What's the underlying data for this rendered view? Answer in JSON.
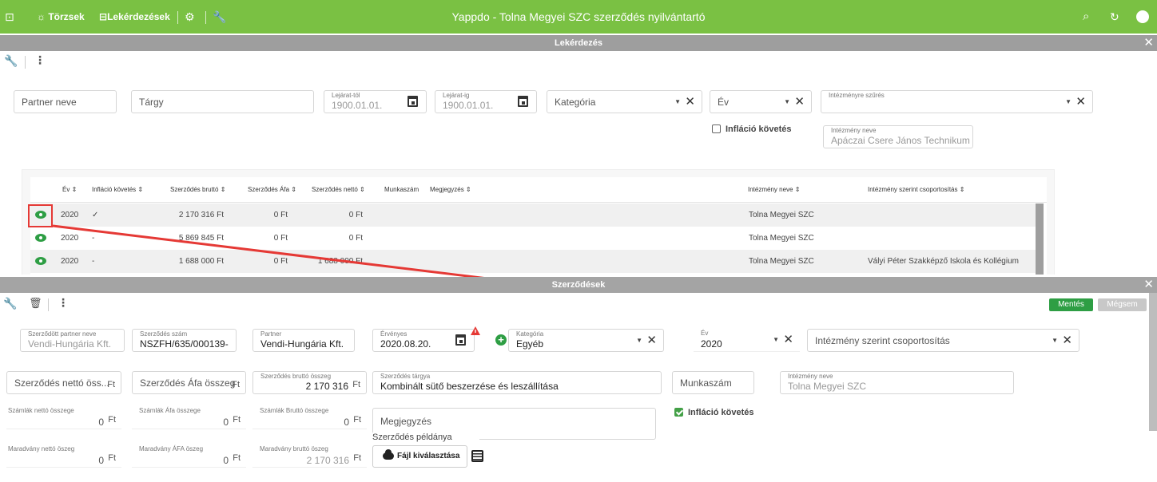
{
  "topbar": {
    "title": "Yappdo - Tolna Megyei SZC szerződés nyilvántartó",
    "nav_torzsek": "Törzsek",
    "nav_lekerdezesek": "Lekérdezések"
  },
  "query_panel": {
    "title": "Lekérdezés",
    "filters": {
      "partner_placeholder": "Partner neve",
      "targy_placeholder": "Tárgy",
      "lejarat_tol_label": "Lejárat-tól",
      "lejarat_tol_value": "1900.01.01.",
      "lejarat_ig_label": "Lejárat-ig",
      "lejarat_ig_value": "1900.01.01.",
      "kategoria_placeholder": "Kategória",
      "ev_placeholder": "Év",
      "intezmenyre_label": "Intézményre szűrés",
      "inflacio_label": "Infláció követés",
      "intezmeny_neve_label": "Intézmény neve",
      "intezmeny_neve_value": "Apáczai Csere János Technikum"
    },
    "grid": {
      "headers": {
        "ev": "Év",
        "inflacio": "Infláció követés",
        "brutto": "Szerződés bruttó",
        "afa": "Szerződés Áfa",
        "netto": "Szerződés nettó",
        "munkaszam": "Munkaszám",
        "megjegyzes": "Megjegyzés",
        "intezmeny": "Intézmény neve",
        "csoport": "Intézmény szerint csoportosítás"
      },
      "sort_glyph": "⇕",
      "rows": [
        {
          "ev": "2020",
          "inflacio": "✓",
          "brutto": "2 170 316 Ft",
          "afa": "0 Ft",
          "netto": "0 Ft",
          "intezmeny": "Tolna Megyei SZC",
          "csoport": ""
        },
        {
          "ev": "2020",
          "inflacio": "-",
          "brutto": "5 869 845 Ft",
          "afa": "0 Ft",
          "netto": "0 Ft",
          "intezmeny": "Tolna Megyei SZC",
          "csoport": ""
        },
        {
          "ev": "2020",
          "inflacio": "-",
          "brutto": "1 688 000 Ft",
          "afa": "0 Ft",
          "netto": "1 688 000 Ft",
          "intezmeny": "Tolna Megyei SZC",
          "csoport": "Vályi Péter Szakképző Iskola és Kollégium"
        }
      ]
    }
  },
  "contract_panel": {
    "title": "Szerződések",
    "save_label": "Mentés",
    "cancel_label": "Mégsem",
    "fields": {
      "szerzodott_partner_label": "Szerződött partner neve",
      "szerzodott_partner_value": "Vendi-Hungária Kft.",
      "szerzodes_szam_label": "Szerződés szám",
      "szerzodes_szam_value": "NSZFH/635/000139-",
      "partner_label": "Partner",
      "partner_value": "Vendi-Hungária Kft.",
      "ervenyes_label": "Érvényes",
      "ervenyes_value": "2020.08.20.",
      "kategoria_label": "Kategória",
      "kategoria_value": "Egyéb",
      "ev_label": "Év",
      "ev_value": "2020",
      "csoport_placeholder": "Intézmény szerint csoportosítás",
      "netto_placeholder": "Szerződés nettó öss...",
      "afa_placeholder": "Szerződés Áfa összeg",
      "brutto_label": "Szerződés bruttó összeg",
      "brutto_value": "2 170 316",
      "targy_label": "Szerződés tárgya",
      "targy_value": "Kombinált sütő beszerzése és leszállítása",
      "munkaszam_placeholder": "Munkaszám",
      "intezmeny_neve_label": "Intézmény neve",
      "intezmeny_neve_value": "Tolna Megyei SZC",
      "szamlak_netto_label": "Számlák nettó összege",
      "szamlak_netto_value": "0",
      "szamlak_afa_label": "Számlák Áfa összege",
      "szamlak_afa_value": "0",
      "szamlak_brutto_label": "Számlák Bruttó összege",
      "szamlak_brutto_value": "0",
      "megjegyzes_placeholder": "Megjegyzés",
      "peldany_label": "Szerződés példánya",
      "file_button": "Fájl kiválasztása",
      "inflacio_label": "Infláció követés",
      "maradvany_netto_label": "Maradvány nettó öszeg",
      "maradvany_netto_value": "0",
      "maradvany_afa_label": "Maradvány ÁFA öszeg",
      "maradvany_afa_value": "0",
      "maradvany_brutto_label": "Maradvány bruttó öszeg",
      "maradvany_brutto_value": "2 170 316",
      "currency": "Ft"
    }
  },
  "colors": {
    "brand_green": "#7ac143",
    "action_green": "#2e9e44",
    "annotation_red": "#e53935",
    "panel_bar_gray": "#9e9e9e"
  }
}
